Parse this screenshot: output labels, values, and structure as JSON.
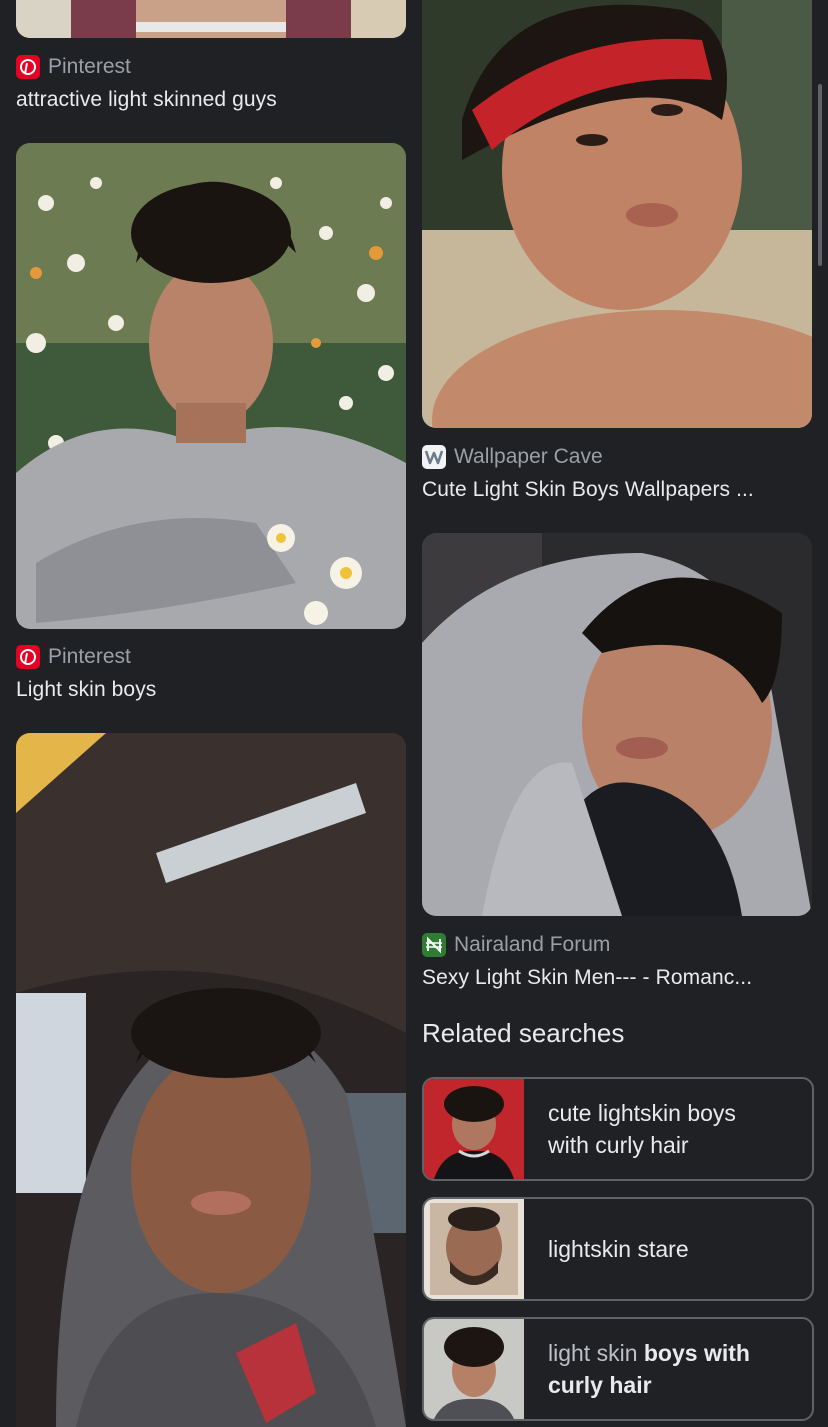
{
  "left_column": [
    {
      "source": "Pinterest",
      "favicon": "pinterest-icon",
      "title": "attractive light skinned guys"
    },
    {
      "source": "Pinterest",
      "favicon": "pinterest-icon",
      "title": "Light skin boys"
    }
  ],
  "right_column": [
    {
      "source": "Wallpaper Cave",
      "favicon": "wallpaper-cave-icon",
      "title": "Cute Light Skin Boys Wallpapers ..."
    },
    {
      "source": "Nairaland Forum",
      "favicon": "nairaland-icon",
      "title": "Sexy Light Skin Men--- - Romanc..."
    }
  ],
  "related": {
    "heading": "Related searches",
    "items": [
      {
        "line1": "cute lightskin boys",
        "line2": "with curly hair"
      },
      {
        "line1": "lightskin stare"
      },
      {
        "plain": "light skin ",
        "bold1": "boys with",
        "bold2": "curly hair"
      }
    ]
  },
  "colors": {
    "background": "#202124",
    "pinterest": "#e60023",
    "nairaland": "#2e7d32",
    "chip_border": "#5f6368"
  }
}
